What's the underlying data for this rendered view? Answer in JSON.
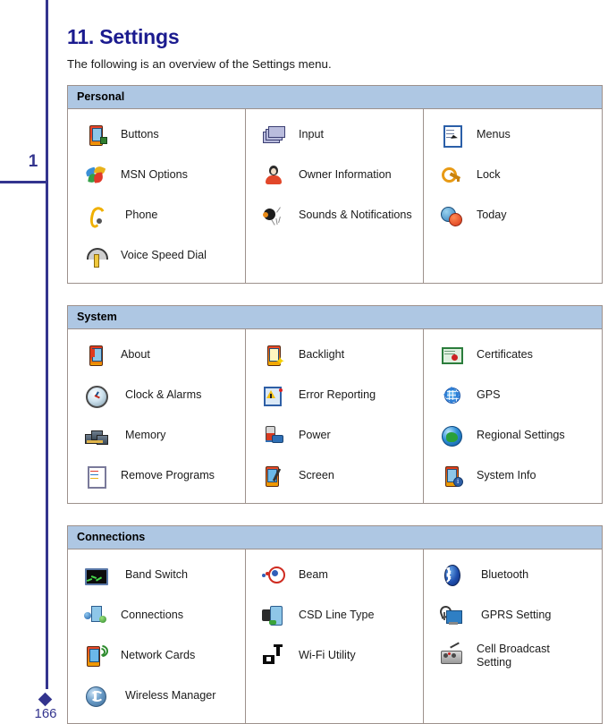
{
  "margin": {
    "tab_number": "1",
    "page_number": "166"
  },
  "page": {
    "title": "11. Settings",
    "intro": "The following is an overview of the Settings menu."
  },
  "sections": [
    {
      "header": "Personal",
      "columns": [
        [
          {
            "icon": "pda-buttons-icon",
            "label": "Buttons"
          },
          {
            "icon": "msn-butterfly-icon",
            "label": "MSN Options"
          },
          {
            "icon": "phone-handset-icon",
            "label": "Phone"
          },
          {
            "icon": "voice-speed-dial-icon",
            "label": "Voice Speed Dial"
          }
        ],
        [
          {
            "icon": "input-cards-icon",
            "label": "Input"
          },
          {
            "icon": "owner-person-icon",
            "label": "Owner Information"
          },
          {
            "icon": "sounds-speaker-icon",
            "label": "Sounds & Notifications"
          }
        ],
        [
          {
            "icon": "menus-list-icon",
            "label": "Menus"
          },
          {
            "icon": "lock-key-icon",
            "label": "Lock"
          },
          {
            "icon": "today-globe-icon",
            "label": "Today"
          }
        ]
      ]
    },
    {
      "header": "System",
      "columns": [
        [
          {
            "icon": "about-device-icon",
            "label": "About"
          },
          {
            "icon": "clock-alarms-icon",
            "label": "Clock & Alarms"
          },
          {
            "icon": "memory-chips-icon",
            "label": "Memory"
          },
          {
            "icon": "remove-programs-icon",
            "label": "Remove Programs"
          }
        ],
        [
          {
            "icon": "backlight-icon",
            "label": "Backlight"
          },
          {
            "icon": "error-reporting-icon",
            "label": "Error Reporting"
          },
          {
            "icon": "power-battery-icon",
            "label": "Power"
          },
          {
            "icon": "screen-stylus-icon",
            "label": "Screen"
          }
        ],
        [
          {
            "icon": "certificates-icon",
            "label": "Certificates"
          },
          {
            "icon": "gps-globe-icon",
            "label": "GPS"
          },
          {
            "icon": "regional-settings-icon",
            "label": "Regional Settings"
          },
          {
            "icon": "system-info-icon",
            "label": "System Info"
          }
        ]
      ]
    },
    {
      "header": "Connections",
      "columns": [
        [
          {
            "icon": "band-switch-icon",
            "label": "Band Switch"
          },
          {
            "icon": "connections-icon",
            "label": "Connections"
          },
          {
            "icon": "network-cards-icon",
            "label": "Network Cards"
          },
          {
            "icon": "wireless-manager-icon",
            "label": "Wireless Manager"
          }
        ],
        [
          {
            "icon": "beam-icon",
            "label": "Beam"
          },
          {
            "icon": "csd-line-type-icon",
            "label": "CSD Line Type"
          },
          {
            "icon": "wifi-utility-icon",
            "label": "Wi-Fi Utility"
          }
        ],
        [
          {
            "icon": "bluetooth-icon",
            "label": "Bluetooth"
          },
          {
            "icon": "gprs-setting-icon",
            "label": "GPRS Setting"
          },
          {
            "icon": "cell-broadcast-icon",
            "label": "Cell Broadcast Setting"
          }
        ]
      ]
    }
  ],
  "colors": {
    "title": "#1b1b8f",
    "header_bar": "#aec7e3",
    "table_border": "#9d918c",
    "margin_accent": "#33348e"
  }
}
